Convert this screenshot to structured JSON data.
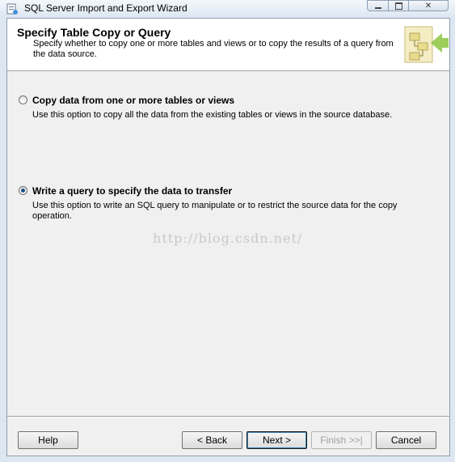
{
  "window": {
    "title": "SQL Server Import and Export Wizard",
    "controls": {
      "minimize": "minimize-icon",
      "maximize": "maximize-icon",
      "close": "✕"
    }
  },
  "header": {
    "title": "Specify Table Copy or Query",
    "subtitle": "Specify whether to copy one or more tables and views or to copy the results of a query from the data source."
  },
  "options": [
    {
      "label": "Copy data from one or more tables or views",
      "description": "Use this option to copy all the data from the existing tables or views in the source database.",
      "selected": false
    },
    {
      "label": "Write a query to specify the data to transfer",
      "description": "Use this option to write an SQL query to manipulate or to restrict the source data for the copy operation.",
      "selected": true
    }
  ],
  "watermark": "http://blog.csdn.net/",
  "buttons": {
    "help": "Help",
    "back": "< Back",
    "next": "Next >",
    "finish": "Finish >>|",
    "cancel": "Cancel"
  },
  "colors": {
    "accent": "#3c7fb1",
    "header_bg": "#ffffff",
    "body_bg": "#f0f0f0",
    "graphic_green": "#8cc63f",
    "graphic_yellow": "#e8dc8c"
  }
}
